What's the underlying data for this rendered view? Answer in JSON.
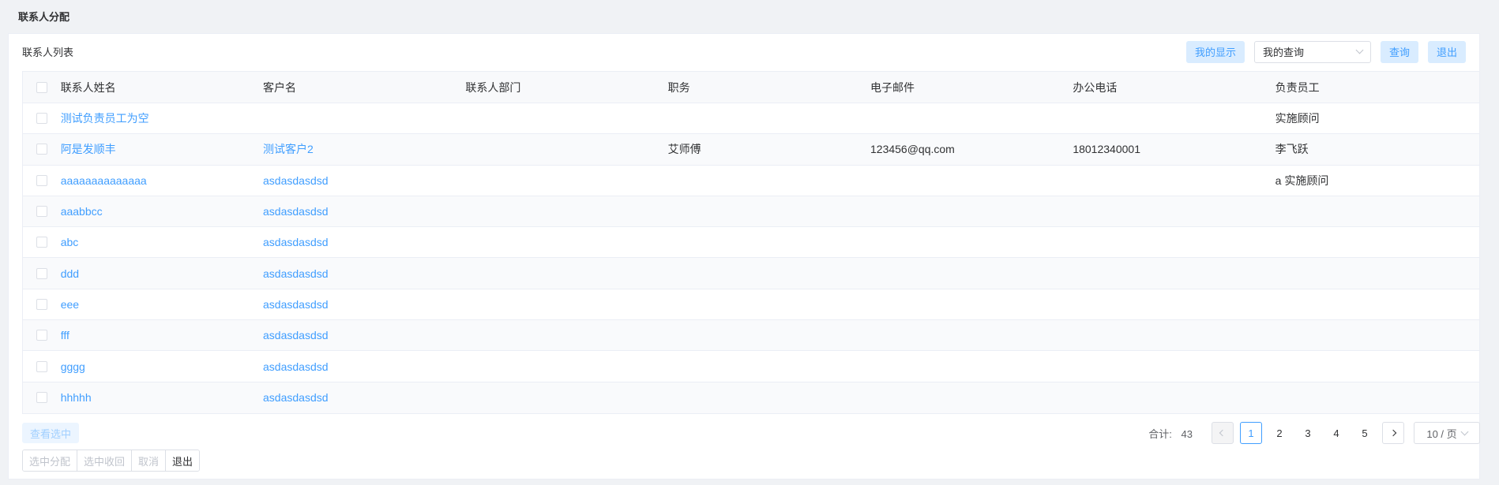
{
  "page": {
    "title": "联系人分配"
  },
  "toolbar": {
    "title": "联系人列表",
    "my_display": "我的显示",
    "query_select": "我的查询",
    "search": "查询",
    "exit": "退出"
  },
  "table": {
    "headers": [
      "联系人姓名",
      "客户名",
      "联系人部门",
      "职务",
      "电子邮件",
      "办公电话",
      "负责员工"
    ],
    "rows": [
      [
        "测试负责员工为空",
        "",
        "",
        "",
        "",
        "",
        "实施顾问"
      ],
      [
        "阿是发顺丰",
        "测试客户2",
        "",
        "艾师傅",
        "123456@qq.com",
        "18012340001",
        "李飞跃"
      ],
      [
        "aaaaaaaaaaaaaa",
        "asdasdasdsd",
        "",
        "",
        "",
        "",
        "a 实施顾问"
      ],
      [
        "aaabbcc",
        "asdasdasdsd",
        "",
        "",
        "",
        "",
        ""
      ],
      [
        "abc",
        "asdasdasdsd",
        "",
        "",
        "",
        "",
        ""
      ],
      [
        "ddd",
        "asdasdasdsd",
        "",
        "",
        "",
        "",
        ""
      ],
      [
        "eee",
        "asdasdasdsd",
        "",
        "",
        "",
        "",
        ""
      ],
      [
        "fff",
        "asdasdasdsd",
        "",
        "",
        "",
        "",
        ""
      ],
      [
        "gggg",
        "asdasdasdsd",
        "",
        "",
        "",
        "",
        ""
      ],
      [
        "hhhhh",
        "asdasdasdsd",
        "",
        "",
        "",
        "",
        ""
      ]
    ]
  },
  "footer": {
    "view_selected": "查看选中",
    "total_label": "合计:",
    "total": "43",
    "pages": [
      "1",
      "2",
      "3",
      "4",
      "5"
    ],
    "page_size": "10 / 页",
    "actions": [
      "选中分配",
      "选中收回",
      "取消",
      "退出"
    ]
  },
  "colors": {
    "primary": "#409eff",
    "border": "#ebeef5",
    "background": "#f0f2f5"
  }
}
